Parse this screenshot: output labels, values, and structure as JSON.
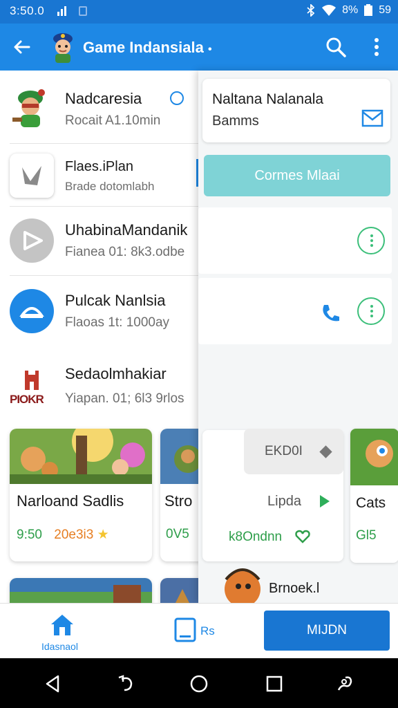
{
  "status_bar": {
    "time": "3:50.0",
    "battery_text": "8%",
    "extra_text": "59"
  },
  "app_bar": {
    "title": "Game Indansiala",
    "title_dot": "•"
  },
  "list": [
    {
      "name": "Nadcaresia",
      "sub": "Rocait A1.10min"
    },
    {
      "name": "Flaes.iPlan",
      "sub": "Brade dotomlabh"
    },
    {
      "name": "UhabinaMandanik",
      "sub": "Fianea 01: 8k3.odbe"
    },
    {
      "name": "Pulcak Nanlsia",
      "sub": "Flaoas 1t: 1000ay"
    },
    {
      "name": "Sedaolmhakiar",
      "sub": "Yiapan. 01; 6l3 9rlos",
      "logo_text": "PIOKR"
    }
  ],
  "cards": [
    {
      "title": "Narloand Sadlis",
      "score": "9:50",
      "rating": "20e3i3"
    },
    {
      "title": "Stro",
      "score": "0V5"
    }
  ],
  "panel": {
    "contact_line1": "Naltana Nalanala",
    "contact_line2": "Bamms",
    "teal_button": "Cormes Mlaai",
    "chip_text": "EKD0I",
    "lipa_text": "Lipda",
    "green_amount": "k8Ondnn",
    "side_card_title": "Cats",
    "side_card_meta": "Gl5",
    "bottom_text": "Brnoek.l"
  },
  "bottom_nav": {
    "home_label": "Idasnaol",
    "tab2_label": "Rs",
    "primary_button": "MIJDN"
  },
  "colors": {
    "primary": "#1e88e5",
    "status": "#1976d2",
    "accent_green": "#3cbf7a",
    "teal": "#7fd3d6"
  }
}
